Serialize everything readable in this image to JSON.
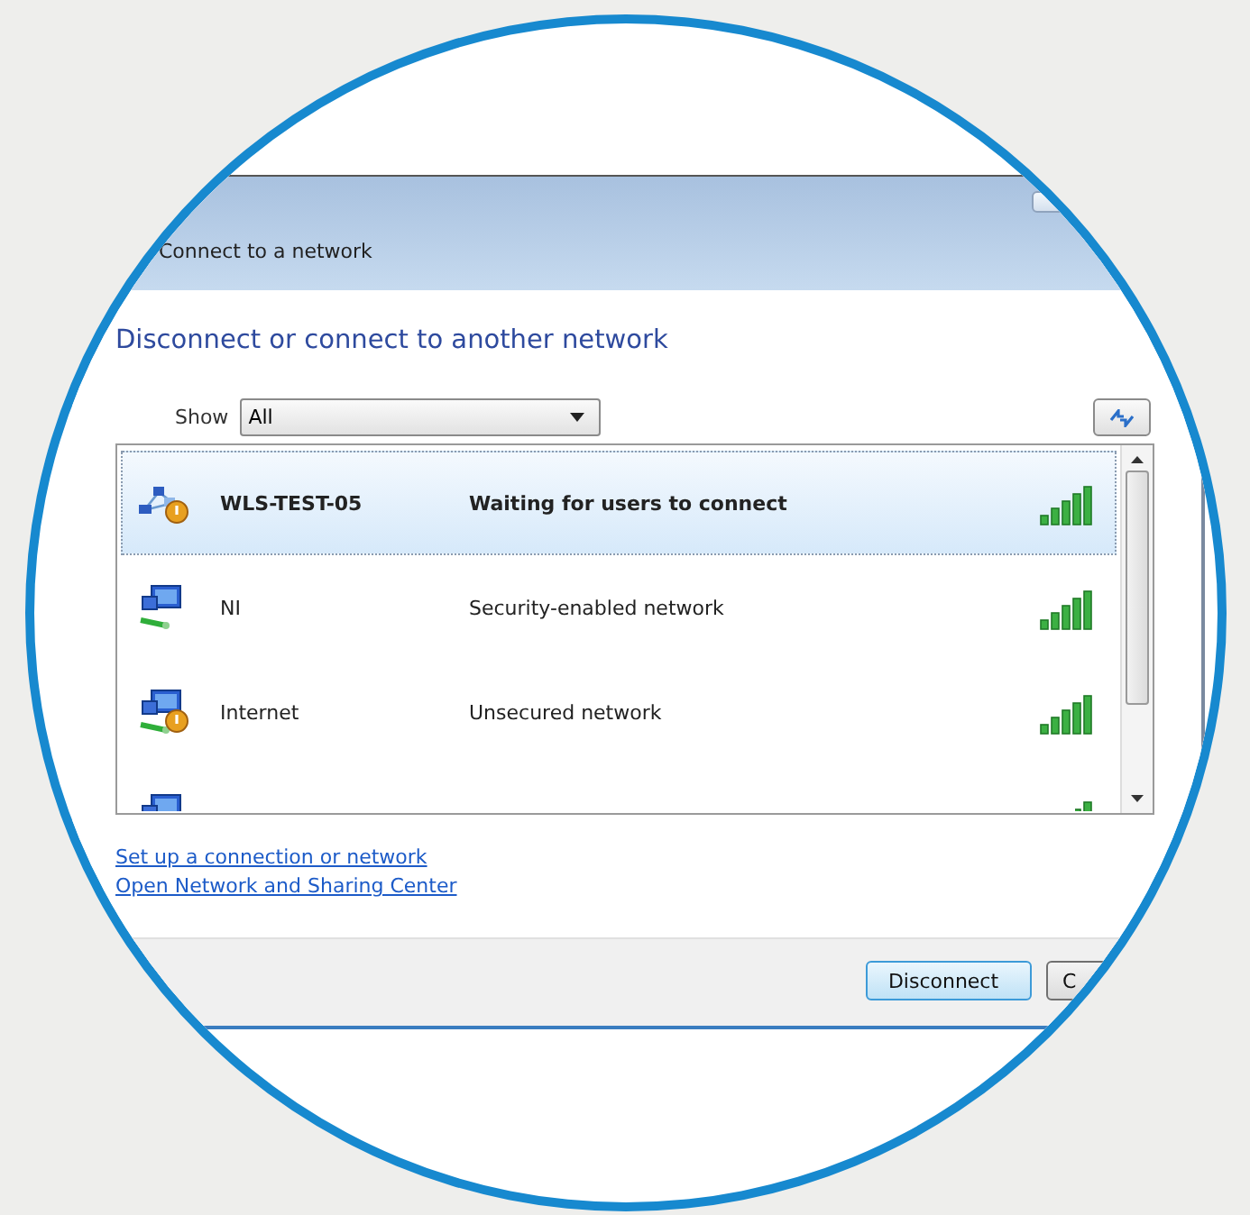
{
  "window": {
    "title": "Connect to a network"
  },
  "heading": "Disconnect or connect to another network",
  "filter": {
    "label": "Show",
    "value": "All"
  },
  "networks": [
    {
      "kind": "adhoc",
      "warning": true,
      "name": "WLS-TEST-05",
      "status": "Waiting for users to connect",
      "selected": true
    },
    {
      "kind": "network",
      "warning": false,
      "name": "NI",
      "status": "Security-enabled network",
      "selected": false
    },
    {
      "kind": "network",
      "warning": true,
      "name": "Internet",
      "status": "Unsecured network",
      "selected": false
    },
    {
      "kind": "network",
      "selected": false
    }
  ],
  "links": [
    "Set up a connection or network",
    "Open Network and Sharing Center"
  ],
  "buttons": [
    {
      "label": "Disconnect",
      "focused": true
    },
    {
      "label": "C",
      "focused": false
    }
  ]
}
